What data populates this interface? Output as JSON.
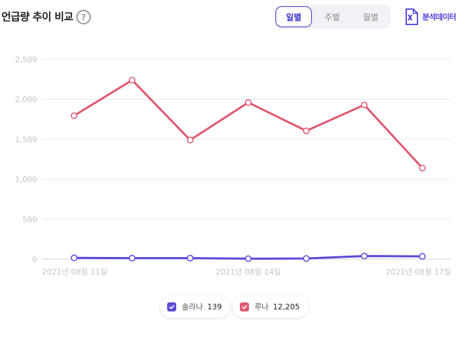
{
  "header": {
    "title": "언급량 추이 비교",
    "help_icon": "?",
    "tabs": [
      {
        "label": "일별",
        "active": true
      },
      {
        "label": "주별",
        "active": false
      },
      {
        "label": "월별",
        "active": false
      }
    ],
    "analysis_label": "분석데이터",
    "analysis_icon": "excel-icon"
  },
  "colors": {
    "accent": "#4b3fd6",
    "luna": "#e05870",
    "solara": "#5a4ad8"
  },
  "chart_data": {
    "type": "line",
    "x": [
      "2021-08-11",
      "2021-08-12",
      "2021-08-13",
      "2021-08-14",
      "2021-08-15",
      "2021-08-16",
      "2021-08-17"
    ],
    "x_tick_labels": [
      "2021년 08월 11일",
      "2021년 08월 14일",
      "2021년 08월 17일"
    ],
    "y_tick_labels": [
      "0",
      "500",
      "1,000",
      "1,500",
      "2,000",
      "2,500"
    ],
    "ylim": [
      0,
      2500
    ],
    "grid": true,
    "series": [
      {
        "name": "솔라나",
        "color": "#5a4ad8",
        "values": [
          15,
          12,
          12,
          5,
          8,
          38,
          34
        ],
        "total": "139"
      },
      {
        "name": "루나",
        "color": "#e05870",
        "values": [
          1795,
          2240,
          1490,
          1960,
          1605,
          1930,
          1140
        ],
        "total": "12,205"
      }
    ],
    "legend": "bottom"
  }
}
